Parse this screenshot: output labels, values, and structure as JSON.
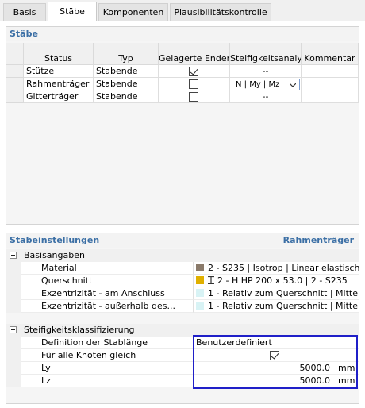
{
  "tabs": [
    "Basis",
    "Stäbe",
    "Komponenten",
    "Plausibilitätskontrolle"
  ],
  "members_panel": {
    "title": "Stäbe",
    "columns": [
      "Status",
      "Typ",
      "Gelagerte Enden",
      "Steifigkeitsanaly",
      "Kommentar"
    ],
    "rows": [
      {
        "status": "Stütze",
        "typ": "Stabende",
        "gelagerte_enden": true,
        "steifigkeit": "--",
        "kommentar": ""
      },
      {
        "status": "Rahmenträger",
        "typ": "Stabende",
        "gelagerte_enden": false,
        "steifigkeit": "N | My | Mz",
        "kommentar": ""
      },
      {
        "status": "Gitterträger",
        "typ": "Stabende",
        "gelagerte_enden": false,
        "steifigkeit": "--",
        "kommentar": ""
      }
    ]
  },
  "settings_panel": {
    "title": "Stabeinstellungen",
    "context": "Rahmenträger",
    "groups": [
      {
        "label": "Basisangaben",
        "props": [
          {
            "name": "Material",
            "value": "2 - S235 | Isotrop | Linear elastisch",
            "swatch": "#8a7a6a"
          },
          {
            "name": "Querschnitt",
            "value": "2 - H HP 200 x 53.0 | 2 - S235",
            "swatch": "#e0b000",
            "icon": "I-beam-icon"
          },
          {
            "name": "Exzentrizität - am Anschluss",
            "value": "1 - Relativ zum Querschnitt | Mitte...",
            "swatch": "#d8f3f5"
          },
          {
            "name": "Exzentrizität - außerhalb des...",
            "value": "1 - Relativ zum Querschnitt | Mitte...",
            "swatch": "#d8f3f5"
          }
        ]
      },
      {
        "label": "Steifigkeitsklassifizierung",
        "props": [
          {
            "name": "Definition der Stablänge",
            "value": "Benutzerdefiniert"
          },
          {
            "name": "Für alle Knoten gleich",
            "checked": true
          },
          {
            "name": "Ly",
            "value": "5000.0",
            "unit": "mm"
          },
          {
            "name": "Lz",
            "value": "5000.0",
            "unit": "mm"
          }
        ]
      }
    ]
  },
  "colors": {
    "accent": "#3b6fa5",
    "highlight_border": "#1f1fc8"
  }
}
